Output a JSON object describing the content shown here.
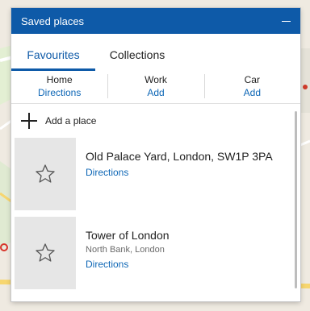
{
  "panel": {
    "title": "Saved places"
  },
  "tabs": [
    {
      "label": "Favourites",
      "active": true
    },
    {
      "label": "Collections",
      "active": false
    }
  ],
  "quick_places": [
    {
      "name": "Home",
      "action": "Directions"
    },
    {
      "name": "Work",
      "action": "Add"
    },
    {
      "name": "Car",
      "action": "Add"
    }
  ],
  "add_place": {
    "label": "Add a place"
  },
  "places": [
    {
      "title": "Old Palace Yard, London, SW1P 3PA",
      "subtitle": "",
      "link": "Directions"
    },
    {
      "title": "Tower of London",
      "subtitle": "North Bank, London",
      "link": "Directions"
    }
  ],
  "colors": {
    "accent": "#0e5aa8",
    "link": "#0e67b6"
  }
}
